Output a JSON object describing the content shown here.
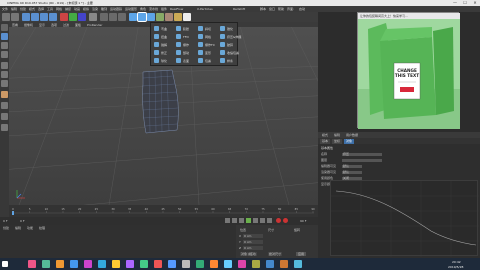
{
  "window": {
    "title": "CINEMA 4D R19.057 Studio (RC - R19) - [未标题 1 *] - 主要",
    "minimize": "—",
    "maximize": "☐",
    "close": "✕"
  },
  "menubar": {
    "items": [
      "文件",
      "编辑",
      "创建",
      "模式",
      "选择",
      "工具",
      "网格",
      "捕捉",
      "动画",
      "模拟",
      "渲染",
      "雕刻",
      "运动跟踪",
      "运动图形",
      "角色",
      "流水线",
      "插件",
      "RealFlow",
      "X-Particles",
      "Redshift",
      "脚本",
      "窗口",
      "帮助",
      "界面:",
      "启动"
    ]
  },
  "viewport_menu": {
    "items": [
      "查看",
      "摄像机",
      "显示",
      "选项",
      "过滤",
      "面板",
      "ProRender"
    ]
  },
  "popup": {
    "items": [
      {
        "label": "弯曲",
        "col": 0,
        "row": 0
      },
      {
        "label": "膨胀",
        "col": 1,
        "row": 0
      },
      {
        "label": "斜切",
        "col": 2,
        "row": 0
      },
      {
        "label": "锥化",
        "col": 3,
        "row": 0
      },
      {
        "label": "扭曲",
        "col": 0,
        "row": 1
      },
      {
        "label": "FFD",
        "col": 1,
        "row": 1
      },
      {
        "label": "网格",
        "col": 2,
        "row": 1
      },
      {
        "label": "挤压&伸展",
        "col": 3,
        "row": 1
      },
      {
        "label": "融解",
        "col": 0,
        "row": 2
      },
      {
        "label": "爆炸",
        "col": 1,
        "row": 2
      },
      {
        "label": "爆炸FX",
        "col": 2,
        "row": 2
      },
      {
        "label": "破碎",
        "col": 3,
        "row": 2
      },
      {
        "label": "修正",
        "col": 0,
        "row": 3
      },
      {
        "label": "颤动",
        "col": 1,
        "row": 3
      },
      {
        "label": "变形",
        "col": 2,
        "row": 3
      },
      {
        "label": "收缩包裹",
        "col": 3,
        "row": 3
      },
      {
        "label": "球化",
        "col": 0,
        "row": 4
      },
      {
        "label": "表面",
        "col": 1,
        "row": 4
      },
      {
        "label": "包裹",
        "col": 2,
        "row": 4
      },
      {
        "label": "样条",
        "col": 3,
        "row": 4
      }
    ]
  },
  "timeline": {
    "ticks": [
      "0",
      "5",
      "10",
      "15",
      "20",
      "25",
      "30",
      "35",
      "40",
      "45",
      "50",
      "55",
      "60",
      "65",
      "70",
      "75",
      "80",
      "85",
      "90"
    ],
    "frame_label": "0 F",
    "start": "0 F",
    "end": "90 F"
  },
  "bottom": {
    "tabs": [
      "创建",
      "编辑",
      "功能",
      "纹理"
    ],
    "coords": {
      "labels": [
        "位置",
        "尺寸",
        "旋转"
      ],
      "x": "X",
      "y": "Y",
      "z": "Z",
      "vals": [
        "0 cm",
        "0 cm",
        "0 cm"
      ],
      "apply": "应用",
      "mode": "对象 (相对)",
      "size_mode": "绝对尺寸"
    }
  },
  "photo": {
    "title": "让你的包装瞬间高大上！快来学习...",
    "bag_text1": "CHANGE",
    "bag_text2": "THIS TEXT"
  },
  "right": {
    "tabs": [
      "模式",
      "编辑",
      "用户数据"
    ],
    "subtabs": [
      "基本",
      "坐标",
      "对象"
    ],
    "section": "基本属性",
    "rows": [
      {
        "label": "名称",
        "value": "挤压"
      },
      {
        "label": "图层",
        "value": ""
      },
      {
        "label": "编辑器可见",
        "value": "默认"
      },
      {
        "label": "渲染器可见",
        "value": "默认"
      },
      {
        "label": "使用颜色",
        "value": "关闭"
      },
      {
        "label": "显示颜色",
        "value": ""
      }
    ]
  },
  "taskbar": {
    "time": "20:42",
    "date": "2019/5/28"
  },
  "colors": {
    "accent": "#4a90d9",
    "bag_green": "#4cae4c",
    "photo_bg": "#8fd08f"
  }
}
